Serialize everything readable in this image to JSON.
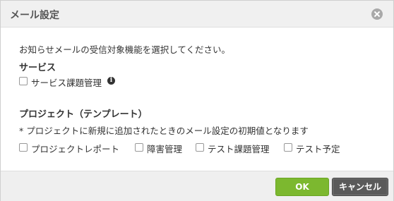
{
  "dialog": {
    "title": "メール設定",
    "close_icon": "close-icon",
    "description": "お知らせメールの受信対象機能を選択してください。"
  },
  "service_section": {
    "heading": "サービス",
    "checkbox_label": "サービス課題管理",
    "checkbox_checked": false,
    "info_icon": "info-icon",
    "info_glyph": "i"
  },
  "project_section": {
    "heading": "プロジェクト（テンプレート）",
    "note": "* プロジェクトに新規に追加されたときのメール設定の初期値となります",
    "checkboxes": [
      {
        "label": "プロジェクトレポート",
        "checked": false
      },
      {
        "label": "障害管理",
        "checked": false
      },
      {
        "label": "テスト課題管理",
        "checked": false
      },
      {
        "label": "テスト予定",
        "checked": false
      }
    ]
  },
  "footer": {
    "ok_label": "OK",
    "cancel_label": "キャンセル"
  },
  "colors": {
    "ok_button": "#7cb82f",
    "cancel_button": "#5a5a5a",
    "header_background": "#f0f0f0"
  }
}
